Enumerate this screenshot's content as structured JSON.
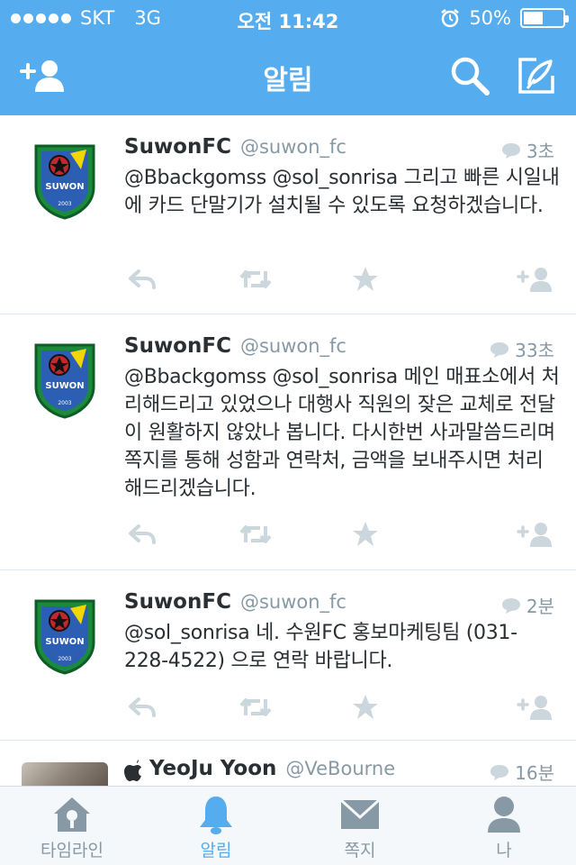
{
  "status_bar": {
    "carrier": "SKT",
    "network": "3G",
    "time": "오전 11:42",
    "battery": "50%",
    "battery_level": 0.5
  },
  "nav": {
    "title": "알림",
    "left_icon": "add-user-icon",
    "right_icons": [
      "search-icon",
      "compose-icon"
    ]
  },
  "tweets": [
    {
      "name": "SuwonFC",
      "handle": "@suwon_fc",
      "time": "3초",
      "text": "@Bbackgomss @sol_sonrisa 그리고 빠른 시일내에 카드 단말기가 설치될 수 있도록 요청하겠습니다."
    },
    {
      "name": "SuwonFC",
      "handle": "@suwon_fc",
      "time": "33초",
      "text": "@Bbackgomss @sol_sonrisa 메인 매표소에서 처리해드리고 있었으나 대행사 직원의 잦은 교체로 전달이 원활하지 않았나 봅니다. 다시한번 사과말씀드리며 쪽지를 통해 성함과 연락처, 금액을 보내주시면 처리해드리겠습니다."
    },
    {
      "name": "SuwonFC",
      "handle": "@suwon_fc",
      "time": "2분",
      "text": "@sol_sonrisa 네. 수원FC 홍보마케팅팀 (031-228-4522) 으로 연락 바랍니다."
    },
    {
      "name": "YeoJu Yoon",
      "handle": "@VeBourne",
      "time": "16분",
      "text": ""
    }
  ],
  "avatar_logo_text": "SUWON",
  "avatar_logo_year": "2003",
  "tabs": [
    {
      "label": "타임라인",
      "icon": "home-icon",
      "active": false
    },
    {
      "label": "알림",
      "icon": "bell-icon",
      "active": true
    },
    {
      "label": "쪽지",
      "icon": "envelope-icon",
      "active": false
    },
    {
      "label": "나",
      "icon": "person-icon",
      "active": false
    }
  ],
  "colors": {
    "brand": "#55acee",
    "text": "#292f33",
    "muted": "#8899a6",
    "icon_gray": "#ccd6dd"
  }
}
